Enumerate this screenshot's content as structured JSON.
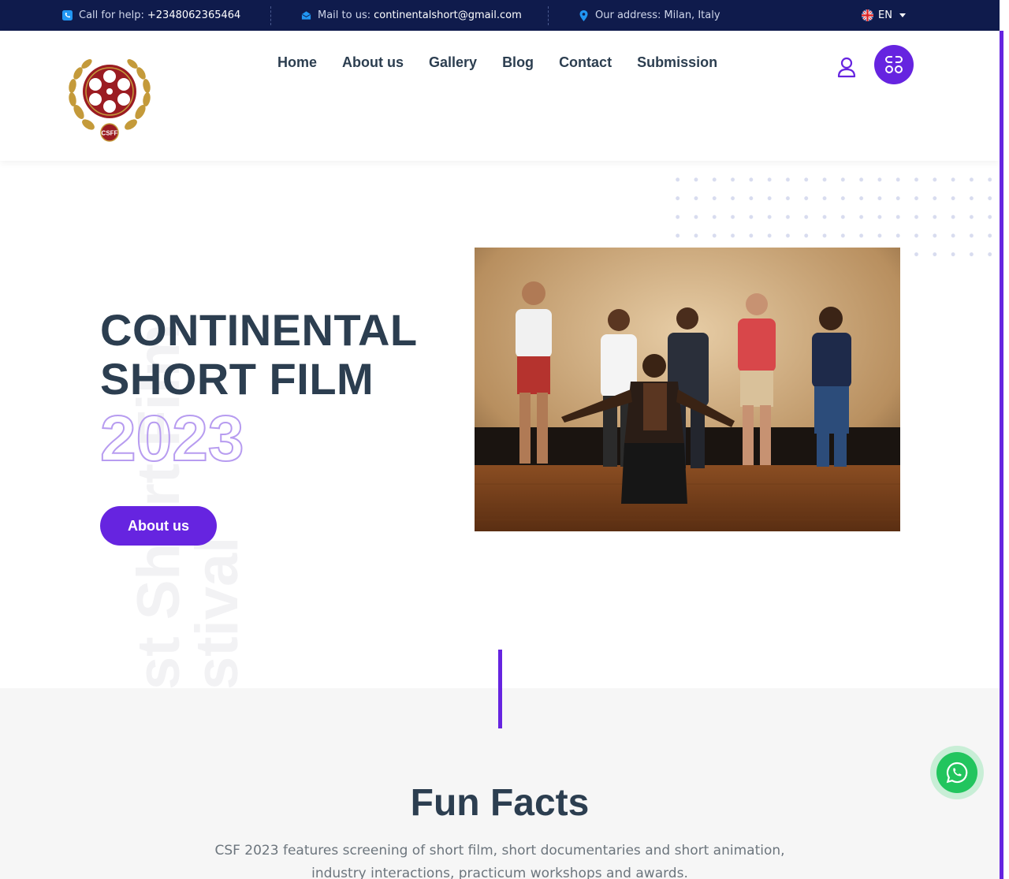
{
  "topbar": {
    "call_label": "Call for help:",
    "call_value": "+2348062365464",
    "mail_label": "Mail to us:",
    "mail_value": "continentalshort@gmail.com",
    "address_label": "Our address:",
    "address_value": "Milan, Italy",
    "language": "EN"
  },
  "header": {
    "logo_text": "CSFF",
    "nav": [
      "Home",
      "About us",
      "Gallery",
      "Blog",
      "Contact",
      "Submission"
    ]
  },
  "hero": {
    "title_line1": "CONTINENTAL",
    "title_line2": "SHORT FILM",
    "year": "2023",
    "vertical_text_1": "st Short Film",
    "vertical_text_2": "stival",
    "button_label": "About us"
  },
  "facts": {
    "title": "Fun Facts",
    "description": "CSF 2023 features screening of short film, short documentaries and short animation, industry interactions, practicum workshops and awards."
  },
  "colors": {
    "topbar_bg": "#0f1b4c",
    "accent": "#6624e0",
    "heading": "#2c3e50",
    "whatsapp": "#22c55e",
    "icon_blue": "#2196f3"
  }
}
